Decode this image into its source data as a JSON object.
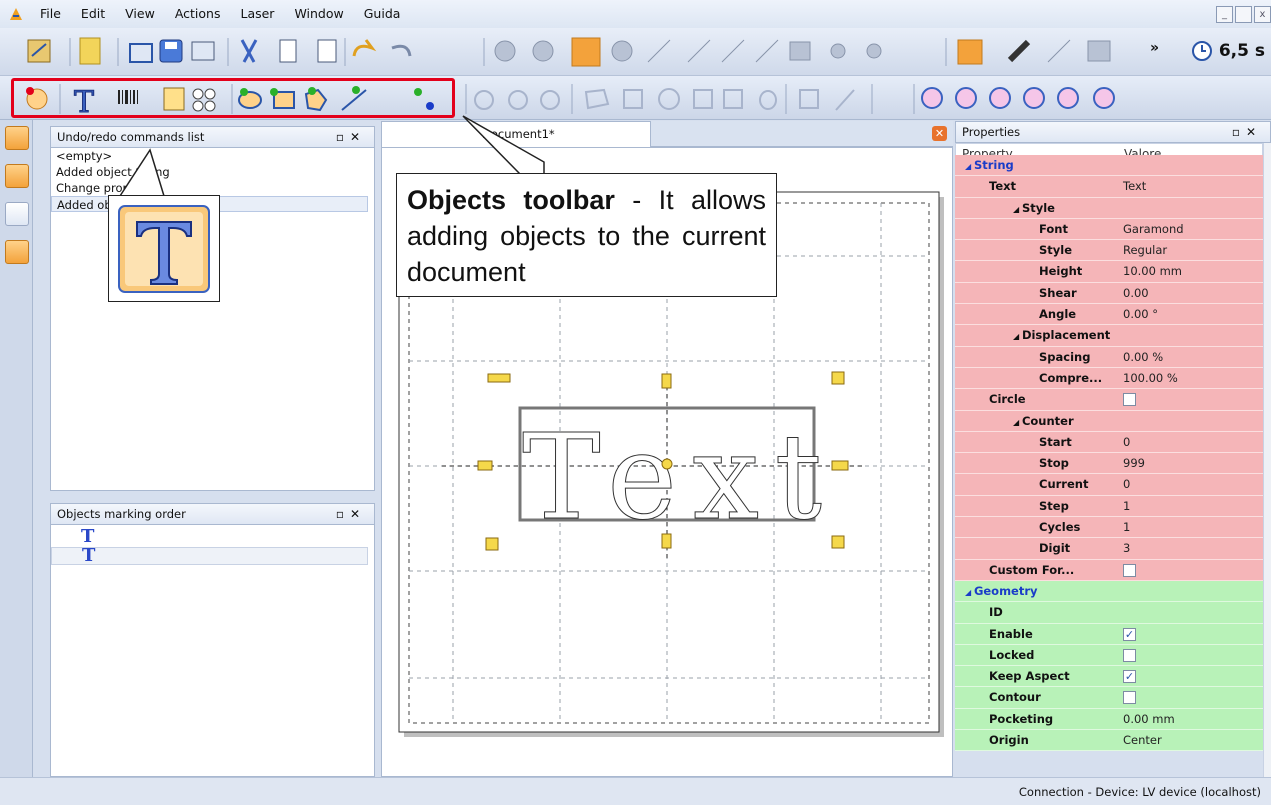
{
  "menu": [
    "File",
    "Edit",
    "View",
    "Actions",
    "Laser",
    "Window",
    "Guida"
  ],
  "window_controls": [
    "_",
    " ",
    "x"
  ],
  "toolbar": {
    "overflow": "»",
    "timer": "6,5 s"
  },
  "left_panel": {
    "undo_title": "Undo/redo commands list",
    "undo_items": [
      "<empty>",
      "Added object String",
      "Change property",
      "Added object"
    ],
    "order_title": "Objects marking order",
    "order_items": [
      "T",
      "T"
    ]
  },
  "document": {
    "tab": "Document1*",
    "text_object": "Text"
  },
  "callout": {
    "bold": "Objects toolbar",
    "text": " - It allows adding objects to the current document"
  },
  "properties": {
    "title": "Properties",
    "header": [
      "Property",
      "Valore"
    ],
    "rows": [
      {
        "name": "String",
        "value": "",
        "indent": 0,
        "cat": true,
        "bg": "red"
      },
      {
        "name": "Text",
        "value": "Text",
        "indent": 2,
        "bg": "red"
      },
      {
        "name": "Style",
        "value": "",
        "indent": 1,
        "exp": true,
        "bg": "red"
      },
      {
        "name": "Font",
        "value": "Garamond",
        "indent": 3,
        "bg": "red"
      },
      {
        "name": "Style",
        "value": "Regular",
        "indent": 3,
        "bg": "red"
      },
      {
        "name": "Height",
        "value": "10.00 mm",
        "indent": 3,
        "bg": "red"
      },
      {
        "name": "Shear",
        "value": "0.00",
        "indent": 3,
        "bg": "red"
      },
      {
        "name": "Angle",
        "value": "0.00 °",
        "indent": 3,
        "bg": "red"
      },
      {
        "name": "Displacement",
        "value": "",
        "indent": 1,
        "exp": true,
        "bg": "red"
      },
      {
        "name": "Spacing",
        "value": "0.00 %",
        "indent": 3,
        "bg": "red"
      },
      {
        "name": "Compre...",
        "value": "100.00 %",
        "indent": 3,
        "bg": "red"
      },
      {
        "name": "Circle",
        "value": "",
        "indent": 2,
        "check": false,
        "bg": "red"
      },
      {
        "name": "Counter",
        "value": "",
        "indent": 1,
        "exp": true,
        "bg": "red"
      },
      {
        "name": "Start",
        "value": "0",
        "indent": 3,
        "bg": "red"
      },
      {
        "name": "Stop",
        "value": "999",
        "indent": 3,
        "bg": "red"
      },
      {
        "name": "Current",
        "value": "0",
        "indent": 3,
        "bg": "red"
      },
      {
        "name": "Step",
        "value": "1",
        "indent": 3,
        "bg": "red"
      },
      {
        "name": "Cycles",
        "value": "1",
        "indent": 3,
        "bg": "red"
      },
      {
        "name": "Digit",
        "value": "3",
        "indent": 3,
        "bg": "red"
      },
      {
        "name": "Custom For...",
        "value": "",
        "indent": 2,
        "check": false,
        "bg": "red"
      },
      {
        "name": "Geometry",
        "value": "",
        "indent": 0,
        "cat": true,
        "bg": "green"
      },
      {
        "name": "ID",
        "value": "",
        "indent": 2,
        "bg": "green"
      },
      {
        "name": "Enable",
        "value": "",
        "indent": 2,
        "check": true,
        "bg": "green"
      },
      {
        "name": "Locked",
        "value": "",
        "indent": 2,
        "check": false,
        "bg": "green"
      },
      {
        "name": "Keep Aspect",
        "value": "",
        "indent": 2,
        "check": true,
        "bg": "green"
      },
      {
        "name": "Contour",
        "value": "",
        "indent": 2,
        "check": false,
        "bg": "green"
      },
      {
        "name": "Pocketing",
        "value": "0.00 mm",
        "indent": 2,
        "bg": "green"
      },
      {
        "name": "Origin",
        "value": "Center",
        "indent": 2,
        "bg": "green"
      }
    ]
  },
  "status": "Connection - Device: LV device (localhost)"
}
